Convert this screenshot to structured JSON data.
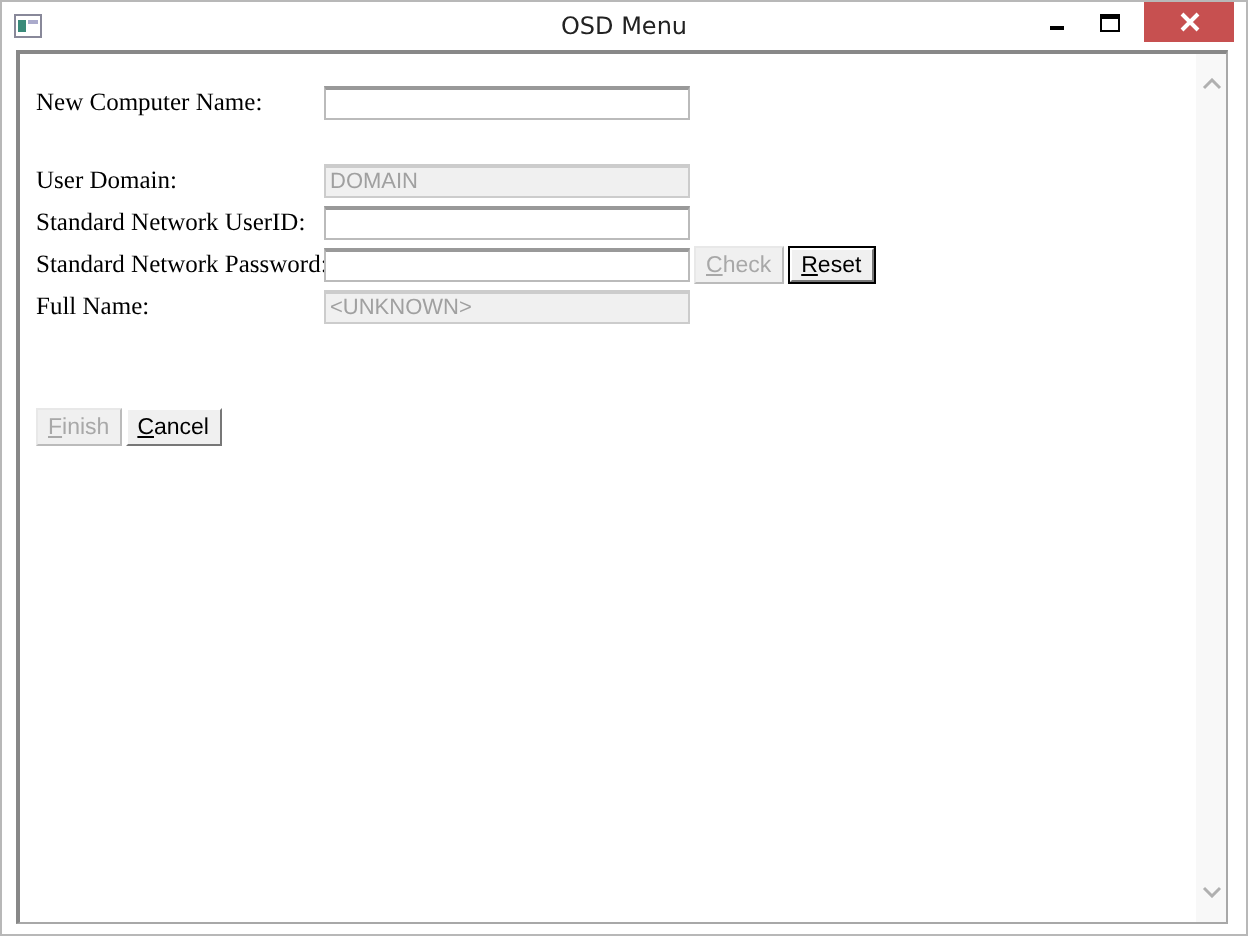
{
  "window": {
    "title": "OSD Menu"
  },
  "sections": [
    {
      "fields": [
        {
          "label": "New Computer Name:",
          "disabled": false
        }
      ]
    },
    {
      "fields": [
        {
          "label": "User Domain:",
          "value": "DOMAIN",
          "disabled": true
        },
        {
          "label": "Standard Network UserID:",
          "disabled": false
        },
        {
          "label": "Standard Network Password:",
          "disabled": false,
          "buttons": [
            {
              "label": "Check",
              "disabled": true,
              "default": false,
              "mnemonic": true
            },
            {
              "label": "Reset",
              "disabled": false,
              "default": true,
              "mnemonic": true
            }
          ]
        },
        {
          "label": "Full Name:",
          "value": "<UNKNOWN>",
          "disabled": true
        }
      ]
    }
  ],
  "buttons": [
    {
      "label": "Finish",
      "disabled": true,
      "default": false,
      "mnemonic": true
    },
    {
      "label": "Cancel",
      "disabled": false,
      "default": false,
      "mnemonic": true
    }
  ]
}
